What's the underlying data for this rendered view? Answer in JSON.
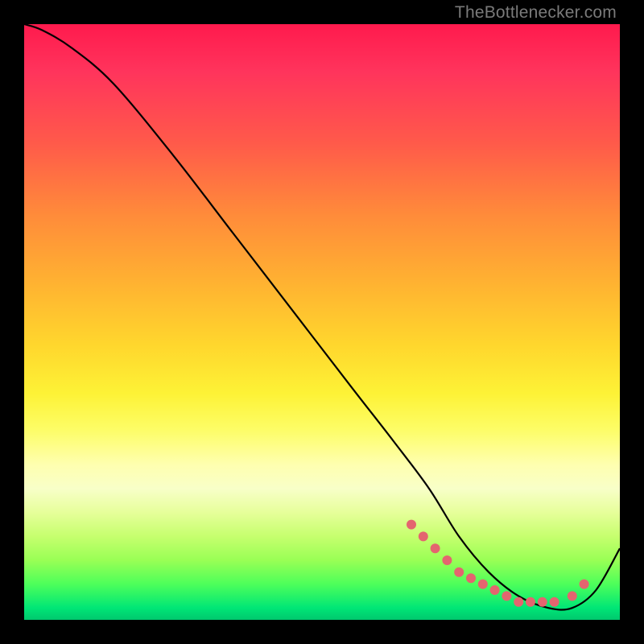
{
  "watermark": "TheBottlenecker.com",
  "chart_data": {
    "type": "line",
    "title": "",
    "xlabel": "",
    "ylabel": "",
    "xlim": [
      0,
      100
    ],
    "ylim": [
      0,
      100
    ],
    "grid": false,
    "series": [
      {
        "name": "curve",
        "color": "#000000",
        "x": [
          0,
          3,
          8,
          15,
          25,
          35,
          45,
          55,
          62,
          68,
          73,
          78,
          83,
          88,
          92,
          96,
          100
        ],
        "values": [
          100,
          99,
          96,
          90,
          78,
          65,
          52,
          39,
          30,
          22,
          14,
          8,
          4,
          2,
          2,
          5,
          12
        ]
      }
    ],
    "markers": {
      "name": "dots",
      "color": "#e4656f",
      "radius": 6,
      "x": [
        65,
        67,
        69,
        71,
        73,
        75,
        77,
        79,
        81,
        83,
        85,
        87,
        89,
        92,
        94
      ],
      "values": [
        16,
        14,
        12,
        10,
        8,
        7,
        6,
        5,
        4,
        3,
        3,
        3,
        3,
        4,
        6
      ]
    }
  }
}
